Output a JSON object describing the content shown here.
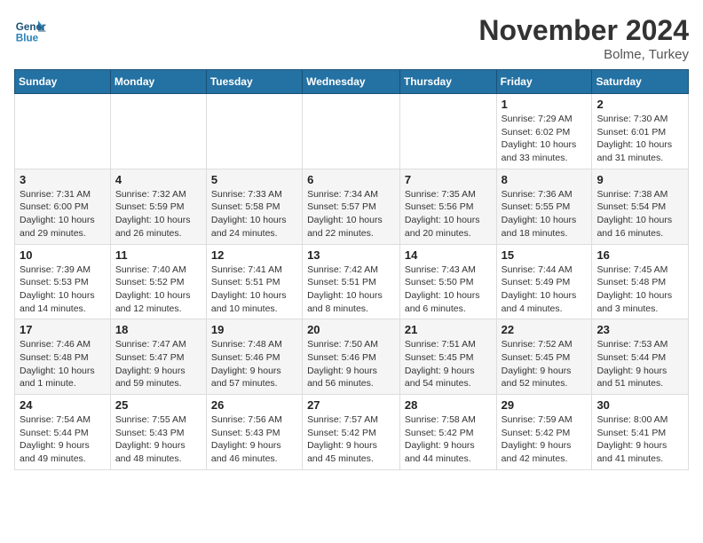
{
  "header": {
    "logo_line1": "General",
    "logo_line2": "Blue",
    "month": "November 2024",
    "location": "Bolme, Turkey"
  },
  "weekdays": [
    "Sunday",
    "Monday",
    "Tuesday",
    "Wednesday",
    "Thursday",
    "Friday",
    "Saturday"
  ],
  "weeks": [
    [
      {
        "day": "",
        "info": ""
      },
      {
        "day": "",
        "info": ""
      },
      {
        "day": "",
        "info": ""
      },
      {
        "day": "",
        "info": ""
      },
      {
        "day": "",
        "info": ""
      },
      {
        "day": "1",
        "info": "Sunrise: 7:29 AM\nSunset: 6:02 PM\nDaylight: 10 hours and 33 minutes."
      },
      {
        "day": "2",
        "info": "Sunrise: 7:30 AM\nSunset: 6:01 PM\nDaylight: 10 hours and 31 minutes."
      }
    ],
    [
      {
        "day": "3",
        "info": "Sunrise: 7:31 AM\nSunset: 6:00 PM\nDaylight: 10 hours and 29 minutes."
      },
      {
        "day": "4",
        "info": "Sunrise: 7:32 AM\nSunset: 5:59 PM\nDaylight: 10 hours and 26 minutes."
      },
      {
        "day": "5",
        "info": "Sunrise: 7:33 AM\nSunset: 5:58 PM\nDaylight: 10 hours and 24 minutes."
      },
      {
        "day": "6",
        "info": "Sunrise: 7:34 AM\nSunset: 5:57 PM\nDaylight: 10 hours and 22 minutes."
      },
      {
        "day": "7",
        "info": "Sunrise: 7:35 AM\nSunset: 5:56 PM\nDaylight: 10 hours and 20 minutes."
      },
      {
        "day": "8",
        "info": "Sunrise: 7:36 AM\nSunset: 5:55 PM\nDaylight: 10 hours and 18 minutes."
      },
      {
        "day": "9",
        "info": "Sunrise: 7:38 AM\nSunset: 5:54 PM\nDaylight: 10 hours and 16 minutes."
      }
    ],
    [
      {
        "day": "10",
        "info": "Sunrise: 7:39 AM\nSunset: 5:53 PM\nDaylight: 10 hours and 14 minutes."
      },
      {
        "day": "11",
        "info": "Sunrise: 7:40 AM\nSunset: 5:52 PM\nDaylight: 10 hours and 12 minutes."
      },
      {
        "day": "12",
        "info": "Sunrise: 7:41 AM\nSunset: 5:51 PM\nDaylight: 10 hours and 10 minutes."
      },
      {
        "day": "13",
        "info": "Sunrise: 7:42 AM\nSunset: 5:51 PM\nDaylight: 10 hours and 8 minutes."
      },
      {
        "day": "14",
        "info": "Sunrise: 7:43 AM\nSunset: 5:50 PM\nDaylight: 10 hours and 6 minutes."
      },
      {
        "day": "15",
        "info": "Sunrise: 7:44 AM\nSunset: 5:49 PM\nDaylight: 10 hours and 4 minutes."
      },
      {
        "day": "16",
        "info": "Sunrise: 7:45 AM\nSunset: 5:48 PM\nDaylight: 10 hours and 3 minutes."
      }
    ],
    [
      {
        "day": "17",
        "info": "Sunrise: 7:46 AM\nSunset: 5:48 PM\nDaylight: 10 hours and 1 minute."
      },
      {
        "day": "18",
        "info": "Sunrise: 7:47 AM\nSunset: 5:47 PM\nDaylight: 9 hours and 59 minutes."
      },
      {
        "day": "19",
        "info": "Sunrise: 7:48 AM\nSunset: 5:46 PM\nDaylight: 9 hours and 57 minutes."
      },
      {
        "day": "20",
        "info": "Sunrise: 7:50 AM\nSunset: 5:46 PM\nDaylight: 9 hours and 56 minutes."
      },
      {
        "day": "21",
        "info": "Sunrise: 7:51 AM\nSunset: 5:45 PM\nDaylight: 9 hours and 54 minutes."
      },
      {
        "day": "22",
        "info": "Sunrise: 7:52 AM\nSunset: 5:45 PM\nDaylight: 9 hours and 52 minutes."
      },
      {
        "day": "23",
        "info": "Sunrise: 7:53 AM\nSunset: 5:44 PM\nDaylight: 9 hours and 51 minutes."
      }
    ],
    [
      {
        "day": "24",
        "info": "Sunrise: 7:54 AM\nSunset: 5:44 PM\nDaylight: 9 hours and 49 minutes."
      },
      {
        "day": "25",
        "info": "Sunrise: 7:55 AM\nSunset: 5:43 PM\nDaylight: 9 hours and 48 minutes."
      },
      {
        "day": "26",
        "info": "Sunrise: 7:56 AM\nSunset: 5:43 PM\nDaylight: 9 hours and 46 minutes."
      },
      {
        "day": "27",
        "info": "Sunrise: 7:57 AM\nSunset: 5:42 PM\nDaylight: 9 hours and 45 minutes."
      },
      {
        "day": "28",
        "info": "Sunrise: 7:58 AM\nSunset: 5:42 PM\nDaylight: 9 hours and 44 minutes."
      },
      {
        "day": "29",
        "info": "Sunrise: 7:59 AM\nSunset: 5:42 PM\nDaylight: 9 hours and 42 minutes."
      },
      {
        "day": "30",
        "info": "Sunrise: 8:00 AM\nSunset: 5:41 PM\nDaylight: 9 hours and 41 minutes."
      }
    ]
  ]
}
